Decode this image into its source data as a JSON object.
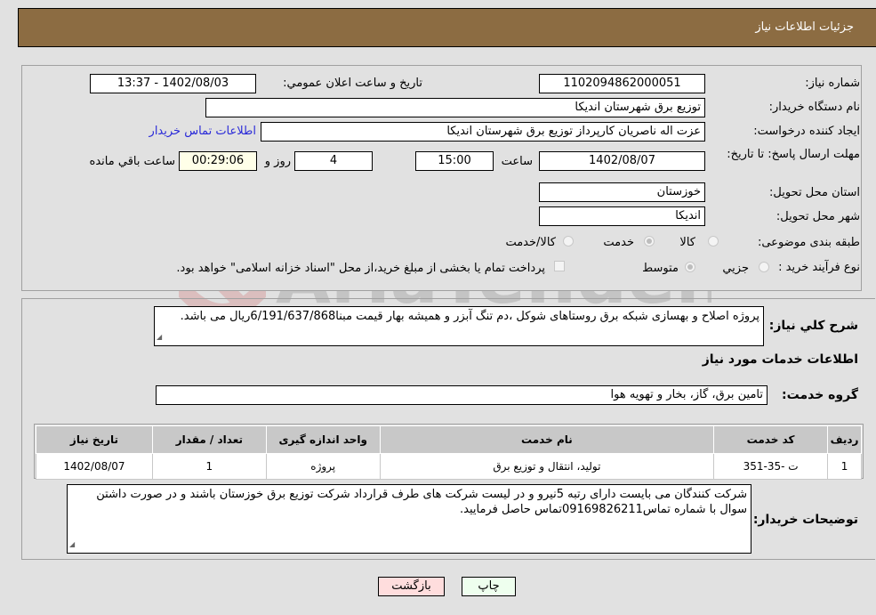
{
  "header": {
    "title": "جزئیات اطلاعات نیاز"
  },
  "fields": {
    "need_number": {
      "label": "شماره نیاز:",
      "value": "1102094862000051"
    },
    "announce_datetime": {
      "label": "تاریخ و ساعت اعلان عمومي:",
      "value": "1402/08/03 - 13:37"
    },
    "buyer_org": {
      "label": "نام دستگاه خریدار:",
      "value": "توزیع برق شهرستان اندیکا"
    },
    "requester": {
      "label": "ایجاد کننده درخواست:",
      "value": "عزت اله ناصریان کارپرداز توزیع برق شهرستان اندیکا",
      "contact_link": "اطلاعات تماس خریدار"
    },
    "deadline": {
      "label": "مهلت ارسال پاسخ: تا تاریخ:",
      "date": "1402/08/07",
      "time_label": "ساعت",
      "time": "15:00",
      "days": "4",
      "days_label": "روز و",
      "remaining": "00:29:06",
      "remaining_label": "ساعت باقي مانده"
    },
    "province": {
      "label": "استان محل تحویل:",
      "value": "خوزستان"
    },
    "city": {
      "label": "شهر محل تحویل:",
      "value": "اندیکا"
    },
    "category": {
      "label": "طبقه بندی موضوعی:",
      "options": [
        {
          "label": "کالا",
          "checked": false
        },
        {
          "label": "خدمت",
          "checked": true
        },
        {
          "label": "کالا/خدمت",
          "checked": false
        }
      ]
    },
    "process_type": {
      "label": "نوع فرآیند خرید :",
      "options": [
        {
          "label": "جزيي",
          "checked": false
        },
        {
          "label": "متوسط",
          "checked": true
        }
      ],
      "treasury_note": "پرداخت تمام یا بخشی از مبلغ خرید،از محل \"اسناد خزانه اسلامی\" خواهد بود."
    }
  },
  "description": {
    "label": "شرح کلي نیاز:",
    "value": "پروژه اصلاح و بهسازی شبکه برق روستاهای شوکل ،دم تنگ آبزر و همیشه بهار قیمت مبنا6/191/637/868ریال می باشد."
  },
  "services_section": {
    "title": "اطلاعات خدمات مورد نیاز",
    "group_label": "گروه خدمت:",
    "group_value": "تامین برق، گاز، بخار و تهویه هوا"
  },
  "table": {
    "headers": [
      "ردیف",
      "کد خدمت",
      "نام خدمت",
      "واحد اندازه گیری",
      "تعداد / مقدار",
      "تاریخ نیاز"
    ],
    "rows": [
      [
        "1",
        "ت -35-351",
        "تولید، انتقال و توزیع برق",
        "پروژه",
        "1",
        "1402/08/07"
      ]
    ]
  },
  "buyer_notes": {
    "label": "توضیحات خریدار:",
    "value": "شرکت کنندگان می بایست دارای رتبه 5نیرو و در لیست شرکت های طرف قرارداد شرکت توزیع برق خوزستان باشند و در صورت داشتن سوال با شماره تماس09169826211تماس حاصل فرمایید."
  },
  "buttons": {
    "print": "چاپ",
    "back": "بازگشت"
  },
  "watermark": {
    "text": "AriaTender.neT"
  },
  "colors": {
    "header_bg": "#8c6c42",
    "print_bg": "#eeffee",
    "back_bg": "#ffdddd",
    "link": "#2a2ad8"
  }
}
